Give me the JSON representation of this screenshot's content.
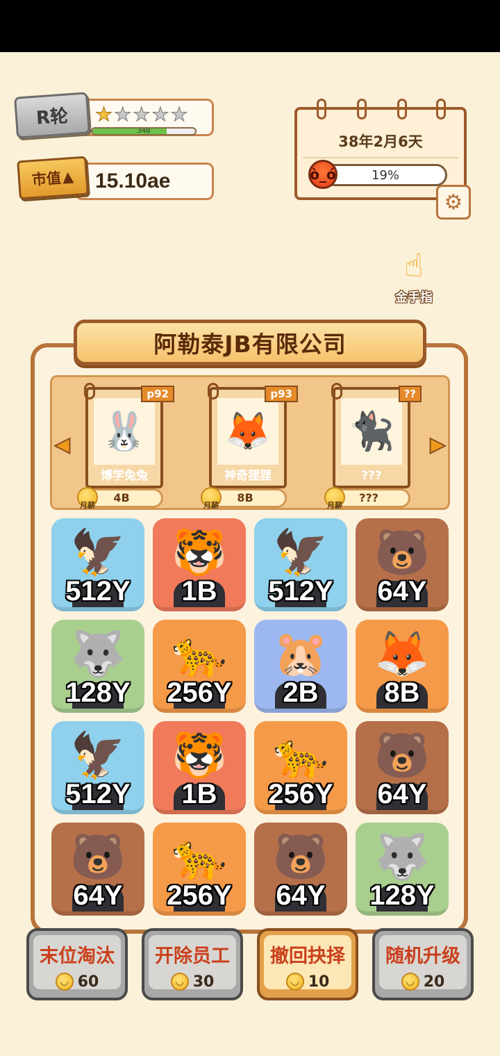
{
  "header": {
    "round_label": "R轮",
    "stars_total": 5,
    "stars_filled": 1,
    "xp_value": "348",
    "xp_progress": 0.72,
    "market_value_label": "市值",
    "market_value": "15.10ae"
  },
  "calendar": {
    "date": "38年2月6天",
    "anger_percent": "19%",
    "anger_progress": 0.19
  },
  "golden_finger": {
    "label": "金手指"
  },
  "company": {
    "name": "阿勒泰JB有限公司",
    "recruits": [
      {
        "tag": "p92",
        "name": "博学兔兔",
        "salary_label": "月薪",
        "salary": "4B",
        "icon": "rabbit"
      },
      {
        "tag": "p93",
        "name": "神奇狸狸",
        "salary_label": "月薪",
        "salary": "8B",
        "icon": "red-panda"
      },
      {
        "tag": "??",
        "name": "???",
        "salary_label": "月薪",
        "salary": "???",
        "icon": "locked-cat"
      }
    ]
  },
  "employees": [
    {
      "animal": "eagle",
      "value": "512Y",
      "color": "#8fd0ec"
    },
    {
      "animal": "tiger",
      "value": "1B",
      "color": "#f07a5a"
    },
    {
      "animal": "eagle",
      "value": "512Y",
      "color": "#8fd0ec"
    },
    {
      "animal": "bear",
      "value": "64Y",
      "color": "#b5704a"
    },
    {
      "animal": "wolf",
      "value": "128Y",
      "color": "#a9cf8f"
    },
    {
      "animal": "leopard",
      "value": "256Y",
      "color": "#f59a48"
    },
    {
      "animal": "hamster",
      "value": "2B",
      "color": "#9db7f0"
    },
    {
      "animal": "red-panda",
      "value": "8B",
      "color": "#f59a48"
    },
    {
      "animal": "eagle",
      "value": "512Y",
      "color": "#8fd0ec"
    },
    {
      "animal": "tiger",
      "value": "1B",
      "color": "#f07a5a"
    },
    {
      "animal": "leopard",
      "value": "256Y",
      "color": "#f59a48"
    },
    {
      "animal": "bear",
      "value": "64Y",
      "color": "#b5704a"
    },
    {
      "animal": "bear",
      "value": "64Y",
      "color": "#b5704a"
    },
    {
      "animal": "leopard",
      "value": "256Y",
      "color": "#f59a48"
    },
    {
      "animal": "bear",
      "value": "64Y",
      "color": "#b5704a"
    },
    {
      "animal": "wolf",
      "value": "128Y",
      "color": "#a9cf8f"
    }
  ],
  "actions": [
    {
      "label": "末位淘汰",
      "cost": "60",
      "active": false
    },
    {
      "label": "开除员工",
      "cost": "30",
      "active": false
    },
    {
      "label": "撤回抉择",
      "cost": "10",
      "active": true
    },
    {
      "label": "随机升级",
      "cost": "20",
      "active": false
    }
  ]
}
